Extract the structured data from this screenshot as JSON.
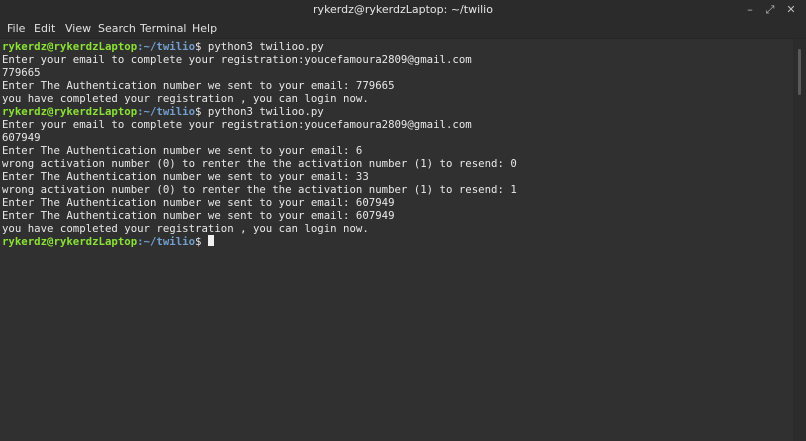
{
  "window": {
    "title": "rykerdz@rykerdzLaptop: ~/twilio",
    "controls": {
      "minimize": "–",
      "maximize": "⤢",
      "close": "✕"
    }
  },
  "menubar": {
    "items": [
      "File",
      "Edit",
      "View",
      "Search",
      "Terminal",
      "Help"
    ]
  },
  "terminal": {
    "prompt": {
      "user": "rykerdz@rykerdzLaptop",
      "path": ":~/twilio",
      "symbol": "$ "
    },
    "lines": [
      {
        "type": "prompt",
        "command": "python3 twilioo.py"
      },
      {
        "type": "output",
        "text": "Enter your email to complete your registration:youcefamoura2809@gmail.com"
      },
      {
        "type": "output",
        "text": "779665"
      },
      {
        "type": "output",
        "text": "Enter The Authentication number we sent to your email: 779665"
      },
      {
        "type": "output",
        "text": "you have completed your registration , you can login now."
      },
      {
        "type": "prompt",
        "command": "python3 twilioo.py"
      },
      {
        "type": "output",
        "text": "Enter your email to complete your registration:youcefamoura2809@gmail.com"
      },
      {
        "type": "output",
        "text": "607949"
      },
      {
        "type": "output",
        "text": "Enter The Authentication number we sent to your email: 6"
      },
      {
        "type": "output",
        "text": "wrong activation number (0) to renter the the activation number (1) to resend: 0"
      },
      {
        "type": "output",
        "text": "Enter The Authentication number we sent to your email: 33"
      },
      {
        "type": "output",
        "text": "wrong activation number (0) to renter the the activation number (1) to resend: 1"
      },
      {
        "type": "output",
        "text": "Enter The Authentication number we sent to your email: 607949"
      },
      {
        "type": "output",
        "text": "Enter The Authentication number we sent to your email: 607949"
      },
      {
        "type": "output",
        "text": "you have completed your registration , you can login now."
      },
      {
        "type": "prompt",
        "command": ""
      }
    ]
  },
  "colors": {
    "prompt_user": "#8ae234",
    "prompt_path": "#729fcf",
    "foreground": "#e8e8e8",
    "background": "#303030"
  }
}
